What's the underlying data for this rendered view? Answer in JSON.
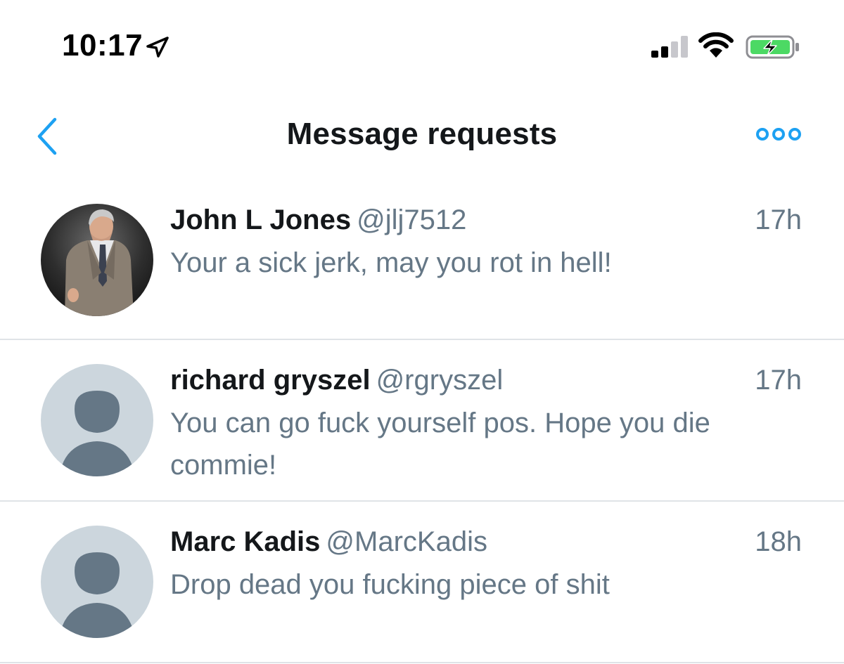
{
  "status_bar": {
    "time": "10:17",
    "icons": [
      "location-arrow-icon",
      "cellular-signal-icon",
      "wifi-icon",
      "battery-charging-icon"
    ],
    "battery_color": "#4cd964"
  },
  "header": {
    "title": "Message requests",
    "back_icon": "chevron-left-icon",
    "more_icon": "more-dots-icon",
    "accent_color": "#1da1f2"
  },
  "messages": [
    {
      "name": "John L Jones",
      "handle": "@jlj7512",
      "time": "17h",
      "preview": "Your a sick jerk, may you rot in hell!",
      "avatar": "profile-photo"
    },
    {
      "name": "richard gryszel",
      "handle": "@rgryszel",
      "time": "17h",
      "preview": "You can go fuck yourself pos. Hope you die commie!",
      "avatar": "default-avatar-icon"
    },
    {
      "name": "Marc Kadis",
      "handle": "@MarcKadis",
      "time": "18h",
      "preview": "Drop dead you fucking piece of shit",
      "avatar": "default-avatar-icon"
    }
  ]
}
